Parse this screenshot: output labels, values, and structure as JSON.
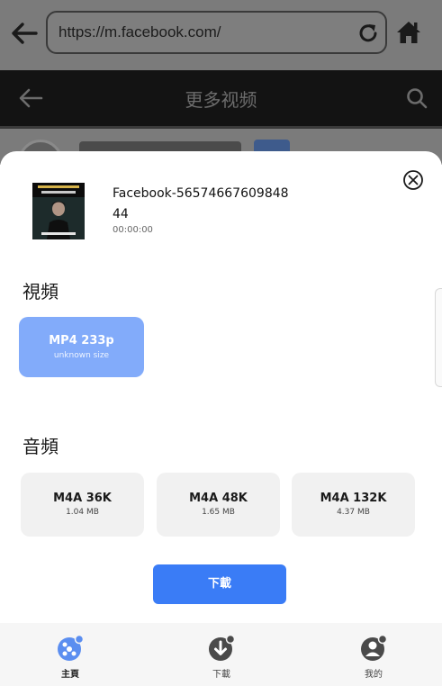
{
  "browser": {
    "url": "https://m.facebook.com/"
  },
  "app_header": {
    "title": "更多视频"
  },
  "media": {
    "title": "Facebook-5657466760984844",
    "duration": "00:00:00"
  },
  "video_section": {
    "label": "視頻",
    "options": [
      {
        "format": "MP4 233p",
        "size": "unknown size",
        "selected": true
      }
    ]
  },
  "audio_section": {
    "label": "音頻",
    "options": [
      {
        "format": "M4A 36K",
        "size": "1.04 MB"
      },
      {
        "format": "M4A 48K",
        "size": "1.65 MB"
      },
      {
        "format": "M4A 132K",
        "size": "4.37 MB"
      }
    ]
  },
  "download_button": {
    "label": "下載"
  },
  "bottom_nav": {
    "items": [
      {
        "label": "主頁",
        "icon": "home-tab-icon",
        "active": true
      },
      {
        "label": "下載",
        "icon": "download-tab-icon",
        "active": false
      },
      {
        "label": "我的",
        "icon": "profile-tab-icon",
        "active": false
      }
    ]
  },
  "colors": {
    "accent": "#3a7cf6",
    "selected_option": "#82abfa",
    "option_bg": "#f1f1f1"
  }
}
